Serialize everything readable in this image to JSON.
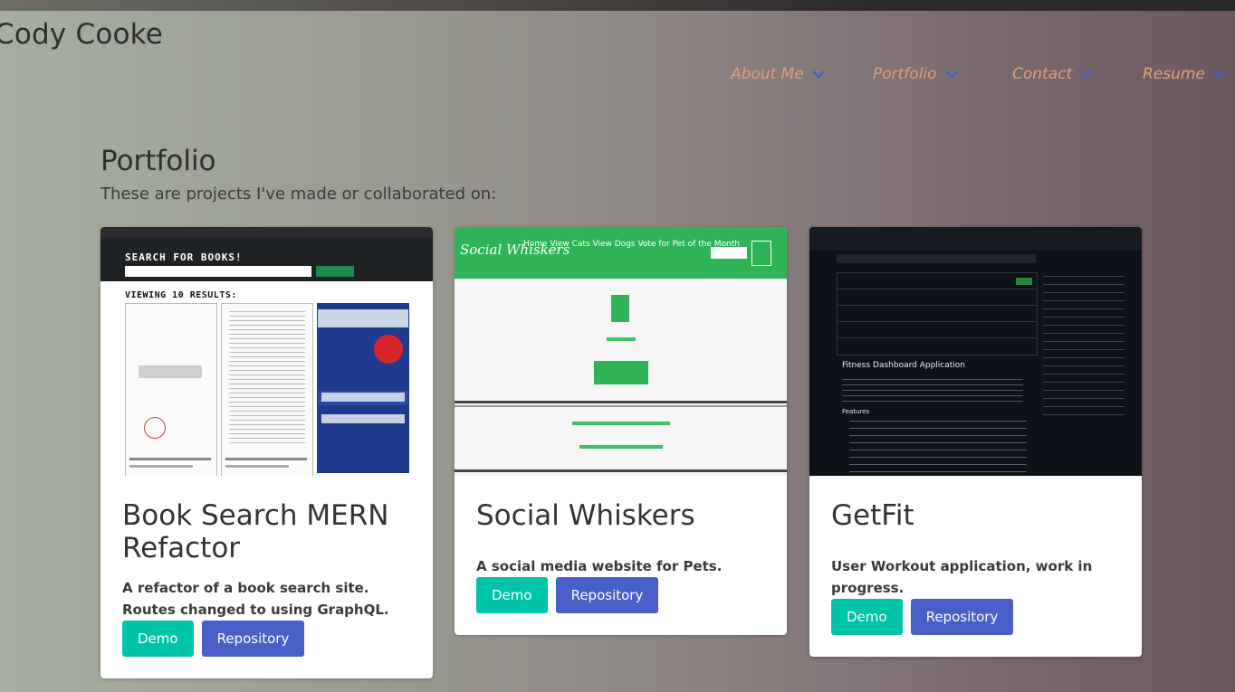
{
  "site": {
    "brand": "Cody Cooke"
  },
  "nav": {
    "items": [
      {
        "label": "About Me"
      },
      {
        "label": "Portfolio"
      },
      {
        "label": "Contact"
      },
      {
        "label": "Resume"
      }
    ]
  },
  "portfolio": {
    "title": "Portfolio",
    "subtitle": "These are projects I've made or collaborated on:",
    "projects": [
      {
        "title": "Book Search MERN Refactor",
        "description": "A refactor of a book search site. Routes changed to using GraphQL.",
        "demo_label": "Demo",
        "repo_label": "Repository",
        "screenshot": {
          "heading": "SEARCH FOR BOOKS!",
          "results": "VIEWING 10 RESULTS:"
        }
      },
      {
        "title": "Social Whiskers",
        "description": "A social media website for Pets.",
        "demo_label": "Demo",
        "repo_label": "Repository",
        "screenshot": {
          "logo": "Social Whiskers",
          "nav_links": "Home  View Cats  View Dogs  Vote for Pet of the Month"
        }
      },
      {
        "title": "GetFit",
        "description": "User Workout application, work in progress.",
        "demo_label": "Demo",
        "repo_label": "Repository",
        "screenshot": {
          "readme_title": "Fitness Dashboard Application",
          "features": "Features"
        }
      }
    ]
  },
  "colors": {
    "nav_text": "#e2a07a",
    "chevron": "#485fc7",
    "demo_button": "#00c4a7",
    "repo_button": "#485fc7"
  }
}
